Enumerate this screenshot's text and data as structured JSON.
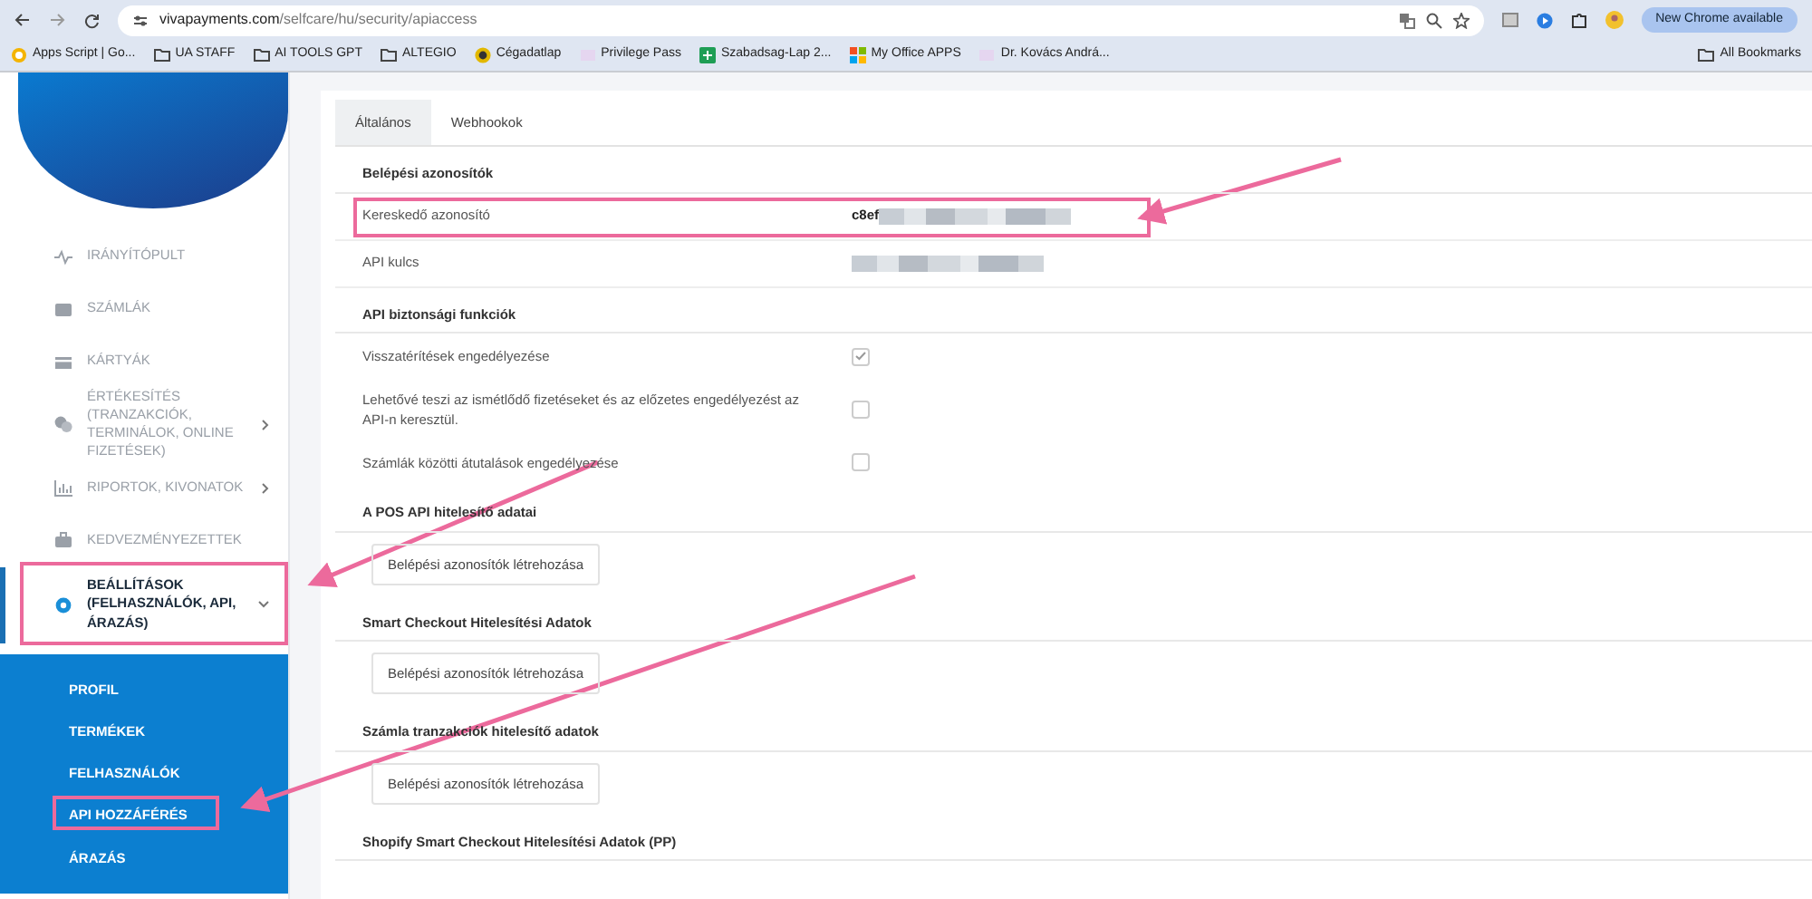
{
  "browser": {
    "url_domain": "vivapayments.com",
    "url_path": "/selfcare/hu/security/apiaccess",
    "update_button": "New Chrome available",
    "bookmarks": [
      {
        "label": "Apps Script | Go...",
        "kind": "app"
      },
      {
        "label": "UA STAFF",
        "kind": "folder"
      },
      {
        "label": "AI TOOLS GPT",
        "kind": "folder"
      },
      {
        "label": "ALTEGIO",
        "kind": "folder"
      },
      {
        "label": "Cégadatlap",
        "kind": "coin"
      },
      {
        "label": "Privilege Pass",
        "kind": "site"
      },
      {
        "label": "Szabadsag-Lap 2...",
        "kind": "sheet"
      },
      {
        "label": "My Office APPS",
        "kind": "office"
      },
      {
        "label": "Dr. Kovács Andrá...",
        "kind": "site"
      }
    ],
    "all_bookmarks": "All Bookmarks"
  },
  "sidebar": {
    "items": [
      {
        "label": "IRÁNYÍTÓPULT",
        "kind": "pulse",
        "has_submenu": false,
        "selected": false,
        "expanded": false
      },
      {
        "label": "SZÁMLÁK",
        "kind": "wallet",
        "has_submenu": false,
        "selected": false,
        "expanded": false
      },
      {
        "label": "KÁRTYÁK",
        "kind": "card",
        "has_submenu": false,
        "selected": false,
        "expanded": false
      },
      {
        "label": "ÉRTÉKESÍTÉS (TRANZAKCIÓK, TERMINÁLOK, ONLINE FIZETÉSEK)",
        "kind": "coins",
        "has_submenu": true,
        "selected": false,
        "expanded": false
      },
      {
        "label": "RIPORTOK, KIVONATOK",
        "kind": "chart",
        "has_submenu": true,
        "selected": false,
        "expanded": false
      },
      {
        "label": "KEDVEZMÉNYEZETTEK",
        "kind": "briefcase",
        "has_submenu": false,
        "selected": false,
        "expanded": false
      },
      {
        "label": "BEÁLLÍTÁSOK (FELHASZNÁLÓK, API, ÁRAZÁS)",
        "kind": "gear",
        "has_submenu": true,
        "selected": true,
        "expanded": true
      }
    ],
    "subitems": [
      {
        "label": "PROFIL"
      },
      {
        "label": "TERMÉKEK"
      },
      {
        "label": "FELHASZNÁLÓK"
      },
      {
        "label": "API HOZZÁFÉRÉS"
      },
      {
        "label": "ÁRAZÁS"
      }
    ]
  },
  "tabs": [
    {
      "label": "Általános",
      "selected": true
    },
    {
      "label": "Webhookok",
      "selected": false
    }
  ],
  "sections": [
    {
      "title": "Belépési azonosítók",
      "rows": [
        {
          "kind": "value",
          "label": "Kereskedő azonosító",
          "value": "c8ef",
          "redacted": true
        },
        {
          "kind": "value",
          "label": "API kulcs",
          "redacted": true
        }
      ]
    },
    {
      "title": "API biztonsági funkciók",
      "rows": [
        {
          "kind": "checkbox",
          "label": "Visszatérítések engedélyezése",
          "checked": true
        },
        {
          "kind": "checkbox",
          "label": "Lehetővé teszi az ismétlődő fizetéseket és az előzetes engedélyezést az API-n keresztül.",
          "checked": false
        },
        {
          "kind": "checkbox",
          "label": "Számlák közötti átutalások engedélyezése",
          "checked": false
        }
      ]
    },
    {
      "title": "A POS API hitelesítő adatai",
      "rows": [
        {
          "kind": "button",
          "label": "Belépési azonosítók létrehozása"
        }
      ]
    },
    {
      "title": "Smart Checkout Hitelesítési Adatok",
      "rows": [
        {
          "kind": "button",
          "label": "Belépési azonosítók létrehozása"
        }
      ]
    },
    {
      "title": "Számla tranzakciók hitelesítő adatok",
      "rows": [
        {
          "kind": "button",
          "label": "Belépési azonosítók létrehozása"
        }
      ]
    },
    {
      "title": "Shopify Smart Checkout Hitelesítési Adatok (PP)"
    }
  ]
}
